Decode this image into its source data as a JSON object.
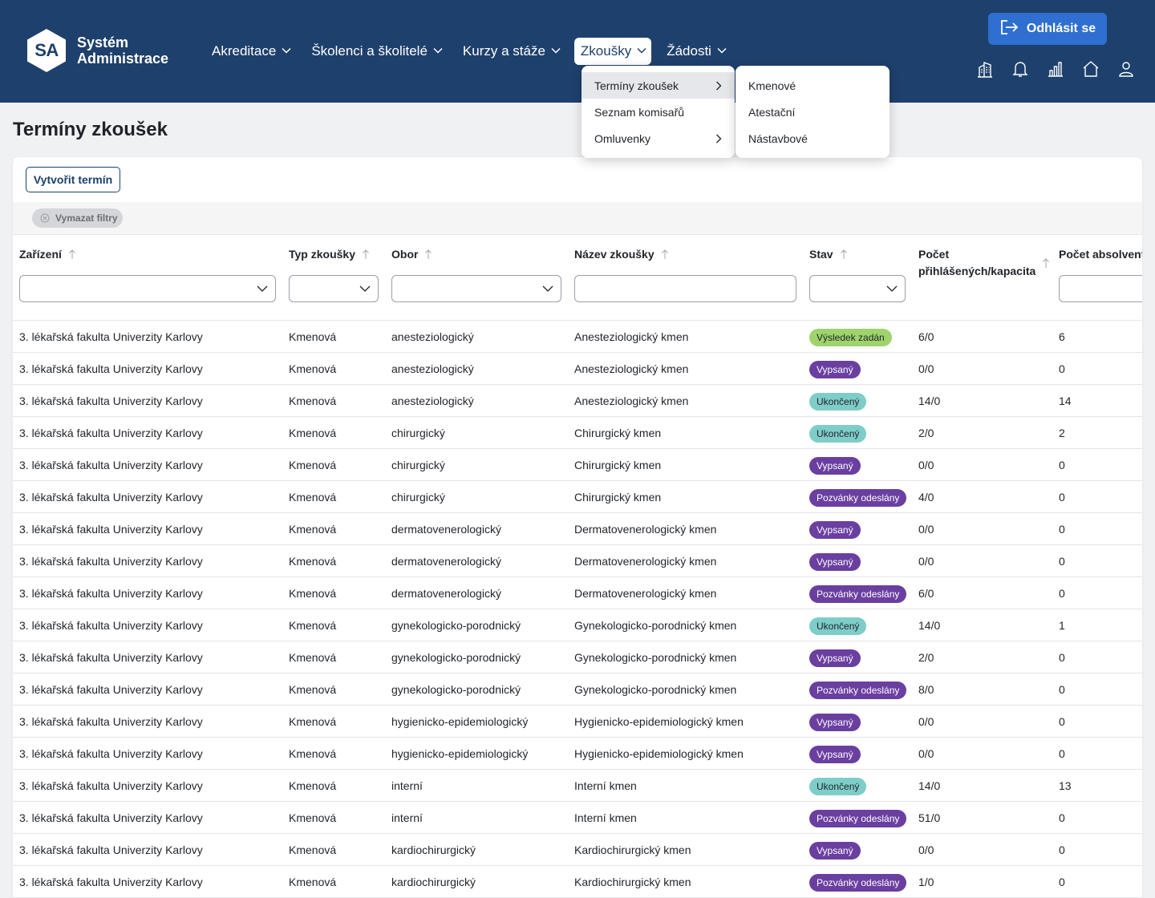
{
  "app": {
    "logo_mark": "SA",
    "logo_line1": "Systém",
    "logo_line2": "Administrace"
  },
  "nav": [
    {
      "label": "Akreditace"
    },
    {
      "label": "Školenci a školitelé"
    },
    {
      "label": "Kurzy a stáže"
    },
    {
      "label": "Zkoušky",
      "active": true
    },
    {
      "label": "Žádosti"
    }
  ],
  "header": {
    "logout_label": "Odhlásit se",
    "icons": [
      "building-icon",
      "bell-icon",
      "bar-chart-icon",
      "home-icon",
      "user-icon"
    ]
  },
  "menu_level1": [
    {
      "label": "Termíny zkoušek",
      "has_sub": true,
      "highlighted": true
    },
    {
      "label": "Seznam komisařů",
      "has_sub": false
    },
    {
      "label": "Omluvenky",
      "has_sub": true
    }
  ],
  "menu_level2": [
    {
      "label": "Kmenové"
    },
    {
      "label": "Atestační"
    },
    {
      "label": "Nástavbové"
    }
  ],
  "page": {
    "title": "Termíny zkoušek",
    "create_label": "Vytvořit termín",
    "clear_filters_label": "Vymazat filtry"
  },
  "columns": {
    "zarizeni": "Zařízení",
    "typ": "Typ zkoušky",
    "obor": "Obor",
    "nazev": "Název zkoušky",
    "stav": "Stav",
    "pocet_line1": "Počet",
    "pocet_line2": "přihlášených/kapacita",
    "absolventu": "Počet absolventů"
  },
  "colors": {
    "header": "#1e406c",
    "accent": "#2e6fd0",
    "badge_green": "#9fd46c",
    "badge_purple": "#6a3fa0",
    "badge_teal": "#7ecdc9"
  },
  "rows": [
    {
      "zarizeni": "3. lékařská fakulta Univerzity Karlovy",
      "typ": "Kmenová",
      "obor": "anesteziologický",
      "nazev": "Anesteziologický kmen",
      "stav": "Výsledek zadán",
      "stav_kind": "green",
      "pocet": "6/0",
      "absolventu": "6"
    },
    {
      "zarizeni": "3. lékařská fakulta Univerzity Karlovy",
      "typ": "Kmenová",
      "obor": "anesteziologický",
      "nazev": "Anesteziologický kmen",
      "stav": "Vypsaný",
      "stav_kind": "purple",
      "pocet": "0/0",
      "absolventu": "0"
    },
    {
      "zarizeni": "3. lékařská fakulta Univerzity Karlovy",
      "typ": "Kmenová",
      "obor": "anesteziologický",
      "nazev": "Anesteziologický kmen",
      "stav": "Ukončený",
      "stav_kind": "teal",
      "pocet": "14/0",
      "absolventu": "14"
    },
    {
      "zarizeni": "3. lékařská fakulta Univerzity Karlovy",
      "typ": "Kmenová",
      "obor": "chirurgický",
      "nazev": "Chirurgický kmen",
      "stav": "Ukončený",
      "stav_kind": "teal",
      "pocet": "2/0",
      "absolventu": "2"
    },
    {
      "zarizeni": "3. lékařská fakulta Univerzity Karlovy",
      "typ": "Kmenová",
      "obor": "chirurgický",
      "nazev": "Chirurgický kmen",
      "stav": "Vypsaný",
      "stav_kind": "purple",
      "pocet": "0/0",
      "absolventu": "0"
    },
    {
      "zarizeni": "3. lékařská fakulta Univerzity Karlovy",
      "typ": "Kmenová",
      "obor": "chirurgický",
      "nazev": "Chirurgický kmen",
      "stav": "Pozvánky odeslány",
      "stav_kind": "purple",
      "pocet": "4/0",
      "absolventu": "0"
    },
    {
      "zarizeni": "3. lékařská fakulta Univerzity Karlovy",
      "typ": "Kmenová",
      "obor": "dermatovenerologický",
      "nazev": "Dermatovenerologický kmen",
      "stav": "Vypsaný",
      "stav_kind": "purple",
      "pocet": "0/0",
      "absolventu": "0"
    },
    {
      "zarizeni": "3. lékařská fakulta Univerzity Karlovy",
      "typ": "Kmenová",
      "obor": "dermatovenerologický",
      "nazev": "Dermatovenerologický kmen",
      "stav": "Vypsaný",
      "stav_kind": "purple",
      "pocet": "0/0",
      "absolventu": "0"
    },
    {
      "zarizeni": "3. lékařská fakulta Univerzity Karlovy",
      "typ": "Kmenová",
      "obor": "dermatovenerologický",
      "nazev": "Dermatovenerologický kmen",
      "stav": "Pozvánky odeslány",
      "stav_kind": "purple",
      "pocet": "6/0",
      "absolventu": "0"
    },
    {
      "zarizeni": "3. lékařská fakulta Univerzity Karlovy",
      "typ": "Kmenová",
      "obor": "gynekologicko-porodnický",
      "nazev": "Gynekologicko-porodnický kmen",
      "stav": "Ukončený",
      "stav_kind": "teal",
      "pocet": "14/0",
      "absolventu": "1"
    },
    {
      "zarizeni": "3. lékařská fakulta Univerzity Karlovy",
      "typ": "Kmenová",
      "obor": "gynekologicko-porodnický",
      "nazev": "Gynekologicko-porodnický kmen",
      "stav": "Vypsaný",
      "stav_kind": "purple",
      "pocet": "2/0",
      "absolventu": "0"
    },
    {
      "zarizeni": "3. lékařská fakulta Univerzity Karlovy",
      "typ": "Kmenová",
      "obor": "gynekologicko-porodnický",
      "nazev": "Gynekologicko-porodnický kmen",
      "stav": "Pozvánky odeslány",
      "stav_kind": "purple",
      "pocet": "8/0",
      "absolventu": "0"
    },
    {
      "zarizeni": "3. lékařská fakulta Univerzity Karlovy",
      "typ": "Kmenová",
      "obor": "hygienicko-epidemiologický",
      "nazev": "Hygienicko-epidemiologický kmen",
      "stav": "Vypsaný",
      "stav_kind": "purple",
      "pocet": "0/0",
      "absolventu": "0"
    },
    {
      "zarizeni": "3. lékařská fakulta Univerzity Karlovy",
      "typ": "Kmenová",
      "obor": "hygienicko-epidemiologický",
      "nazev": "Hygienicko-epidemiologický kmen",
      "stav": "Vypsaný",
      "stav_kind": "purple",
      "pocet": "0/0",
      "absolventu": "0"
    },
    {
      "zarizeni": "3. lékařská fakulta Univerzity Karlovy",
      "typ": "Kmenová",
      "obor": "interní",
      "nazev": "Interní kmen",
      "stav": "Ukončený",
      "stav_kind": "teal",
      "pocet": "14/0",
      "absolventu": "13"
    },
    {
      "zarizeni": "3. lékařská fakulta Univerzity Karlovy",
      "typ": "Kmenová",
      "obor": "interní",
      "nazev": "Interní kmen",
      "stav": "Pozvánky odeslány",
      "stav_kind": "purple",
      "pocet": "51/0",
      "absolventu": "0"
    },
    {
      "zarizeni": "3. lékařská fakulta Univerzity Karlovy",
      "typ": "Kmenová",
      "obor": "kardiochirurgický",
      "nazev": "Kardiochirurgický kmen",
      "stav": "Vypsaný",
      "stav_kind": "purple",
      "pocet": "0/0",
      "absolventu": "0"
    },
    {
      "zarizeni": "3. lékařská fakulta Univerzity Karlovy",
      "typ": "Kmenová",
      "obor": "kardiochirurgický",
      "nazev": "Kardiochirurgický kmen",
      "stav": "Pozvánky odeslány",
      "stav_kind": "purple",
      "pocet": "1/0",
      "absolventu": "0"
    }
  ]
}
